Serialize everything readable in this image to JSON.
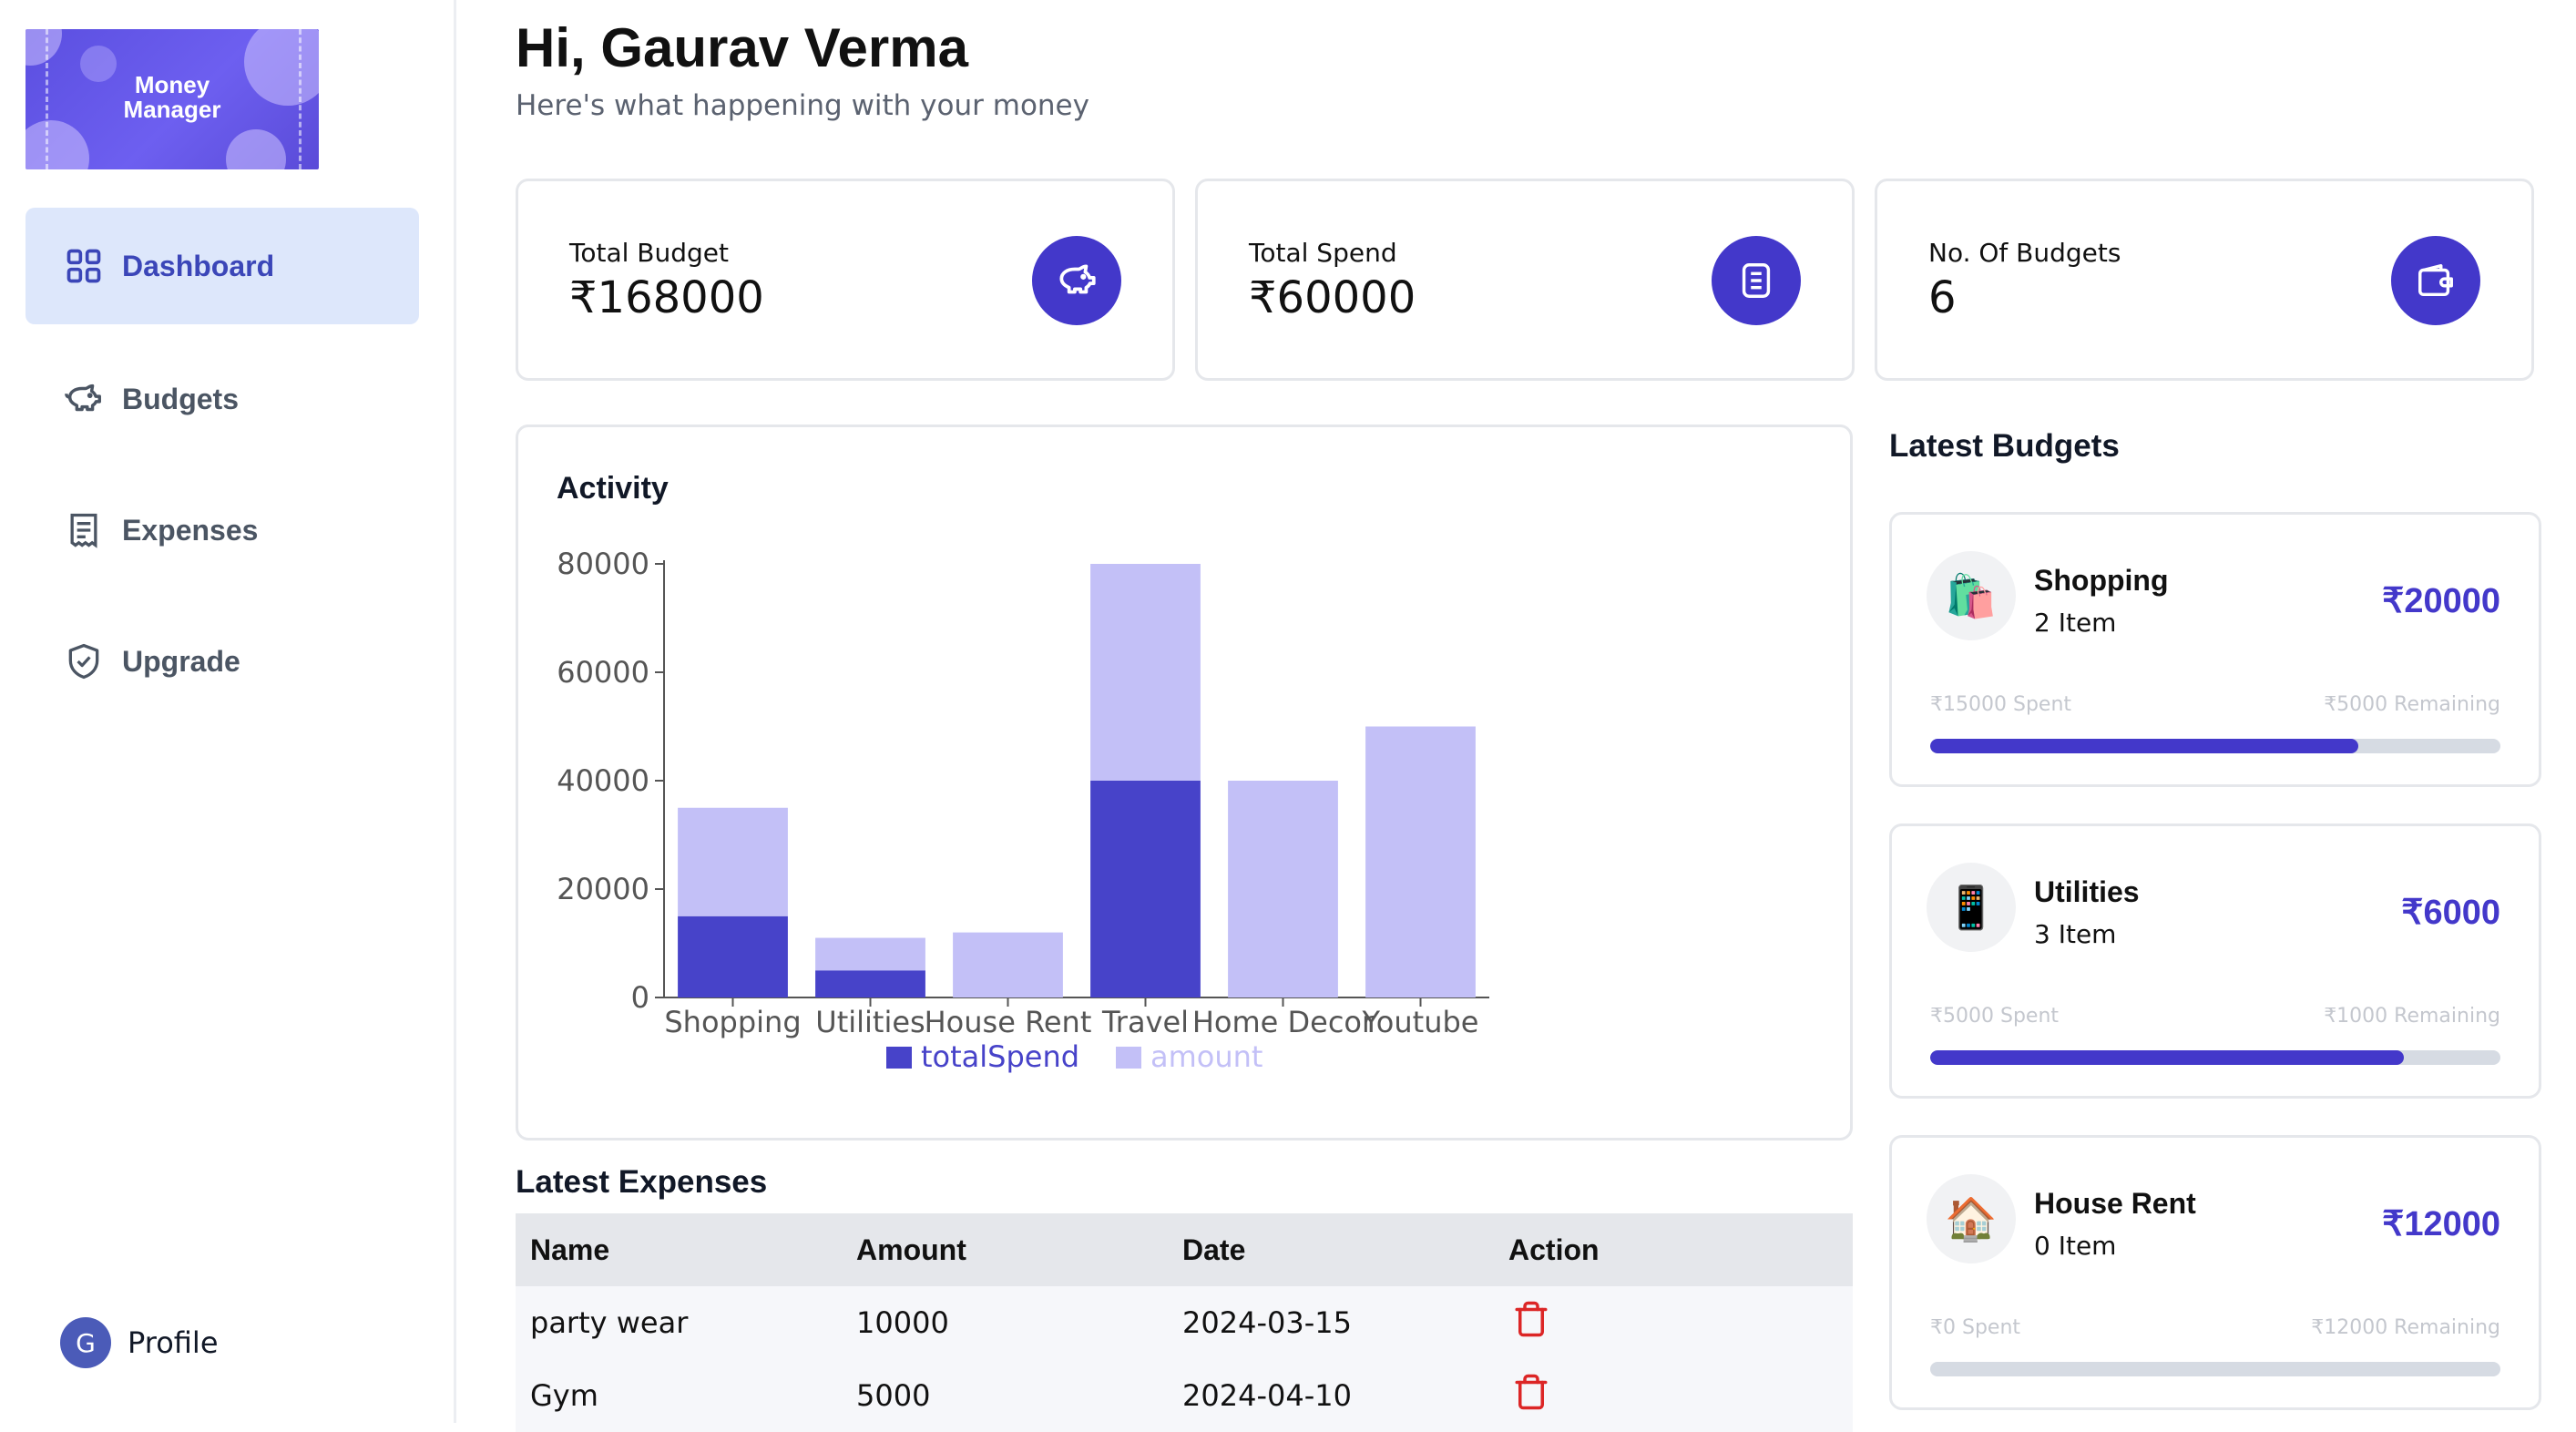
{
  "app": {
    "logo_line1": "Money",
    "logo_line2": "Manager"
  },
  "sidebar": {
    "items": [
      {
        "label": "Dashboard",
        "icon": "grid-icon",
        "active": true
      },
      {
        "label": "Budgets",
        "icon": "piggy-bank-icon",
        "active": false
      },
      {
        "label": "Expenses",
        "icon": "receipt-icon",
        "active": false
      },
      {
        "label": "Upgrade",
        "icon": "shield-check-icon",
        "active": false
      }
    ],
    "profile": {
      "initial": "G",
      "label": "Profile"
    }
  },
  "header": {
    "greeting": "Hi, Gaurav Verma",
    "subtitle": "Here's what happening with your money"
  },
  "stats": [
    {
      "label": "Total Budget",
      "value": "₹168000",
      "icon": "piggy-bank-icon"
    },
    {
      "label": "Total Spend",
      "value": "₹60000",
      "icon": "receipt-icon"
    },
    {
      "label": "No. Of Budgets",
      "value": "6",
      "icon": "wallet-icon"
    }
  ],
  "activity": {
    "title": "Activity"
  },
  "chart_data": {
    "type": "bar",
    "stacked": true,
    "categories": [
      "Shopping",
      "Utilities",
      "House Rent",
      "Travel",
      "Home Decor",
      "Youtube"
    ],
    "series": [
      {
        "name": "totalSpend",
        "color": "#4743c9",
        "values": [
          15000,
          5000,
          0,
          40000,
          0,
          0
        ]
      },
      {
        "name": "amount",
        "color": "#c3c0f7",
        "values": [
          20000,
          6000,
          12000,
          40000,
          40000,
          50000
        ]
      }
    ],
    "ylim": [
      0,
      80000
    ],
    "yticks": [
      0,
      20000,
      40000,
      60000,
      80000
    ],
    "legend": "bottom",
    "grid": false
  },
  "latest_budgets": {
    "title": "Latest Budgets",
    "items": [
      {
        "emoji": "🛍️",
        "name": "Shopping",
        "items": "2 Item",
        "amount": "₹20000",
        "spent": "₹15000 Spent",
        "remaining": "₹5000 Remaining",
        "progress": 0.75
      },
      {
        "emoji": "📱",
        "name": "Utilities",
        "items": "3 Item",
        "amount": "₹6000",
        "spent": "₹5000 Spent",
        "remaining": "₹1000 Remaining",
        "progress": 0.83
      },
      {
        "emoji": "🏠",
        "name": "House Rent",
        "items": "0 Item",
        "amount": "₹12000",
        "spent": "₹0 Spent",
        "remaining": "₹12000 Remaining",
        "progress": 0
      }
    ]
  },
  "latest_expenses": {
    "title": "Latest Expenses",
    "columns": [
      "Name",
      "Amount",
      "Date",
      "Action"
    ],
    "rows": [
      {
        "name": "party wear",
        "amount": "10000",
        "date": "2024-03-15",
        "action_icon": "trash-icon"
      },
      {
        "name": "Gym",
        "amount": "5000",
        "date": "2024-04-10",
        "action_icon": "trash-icon"
      }
    ]
  }
}
